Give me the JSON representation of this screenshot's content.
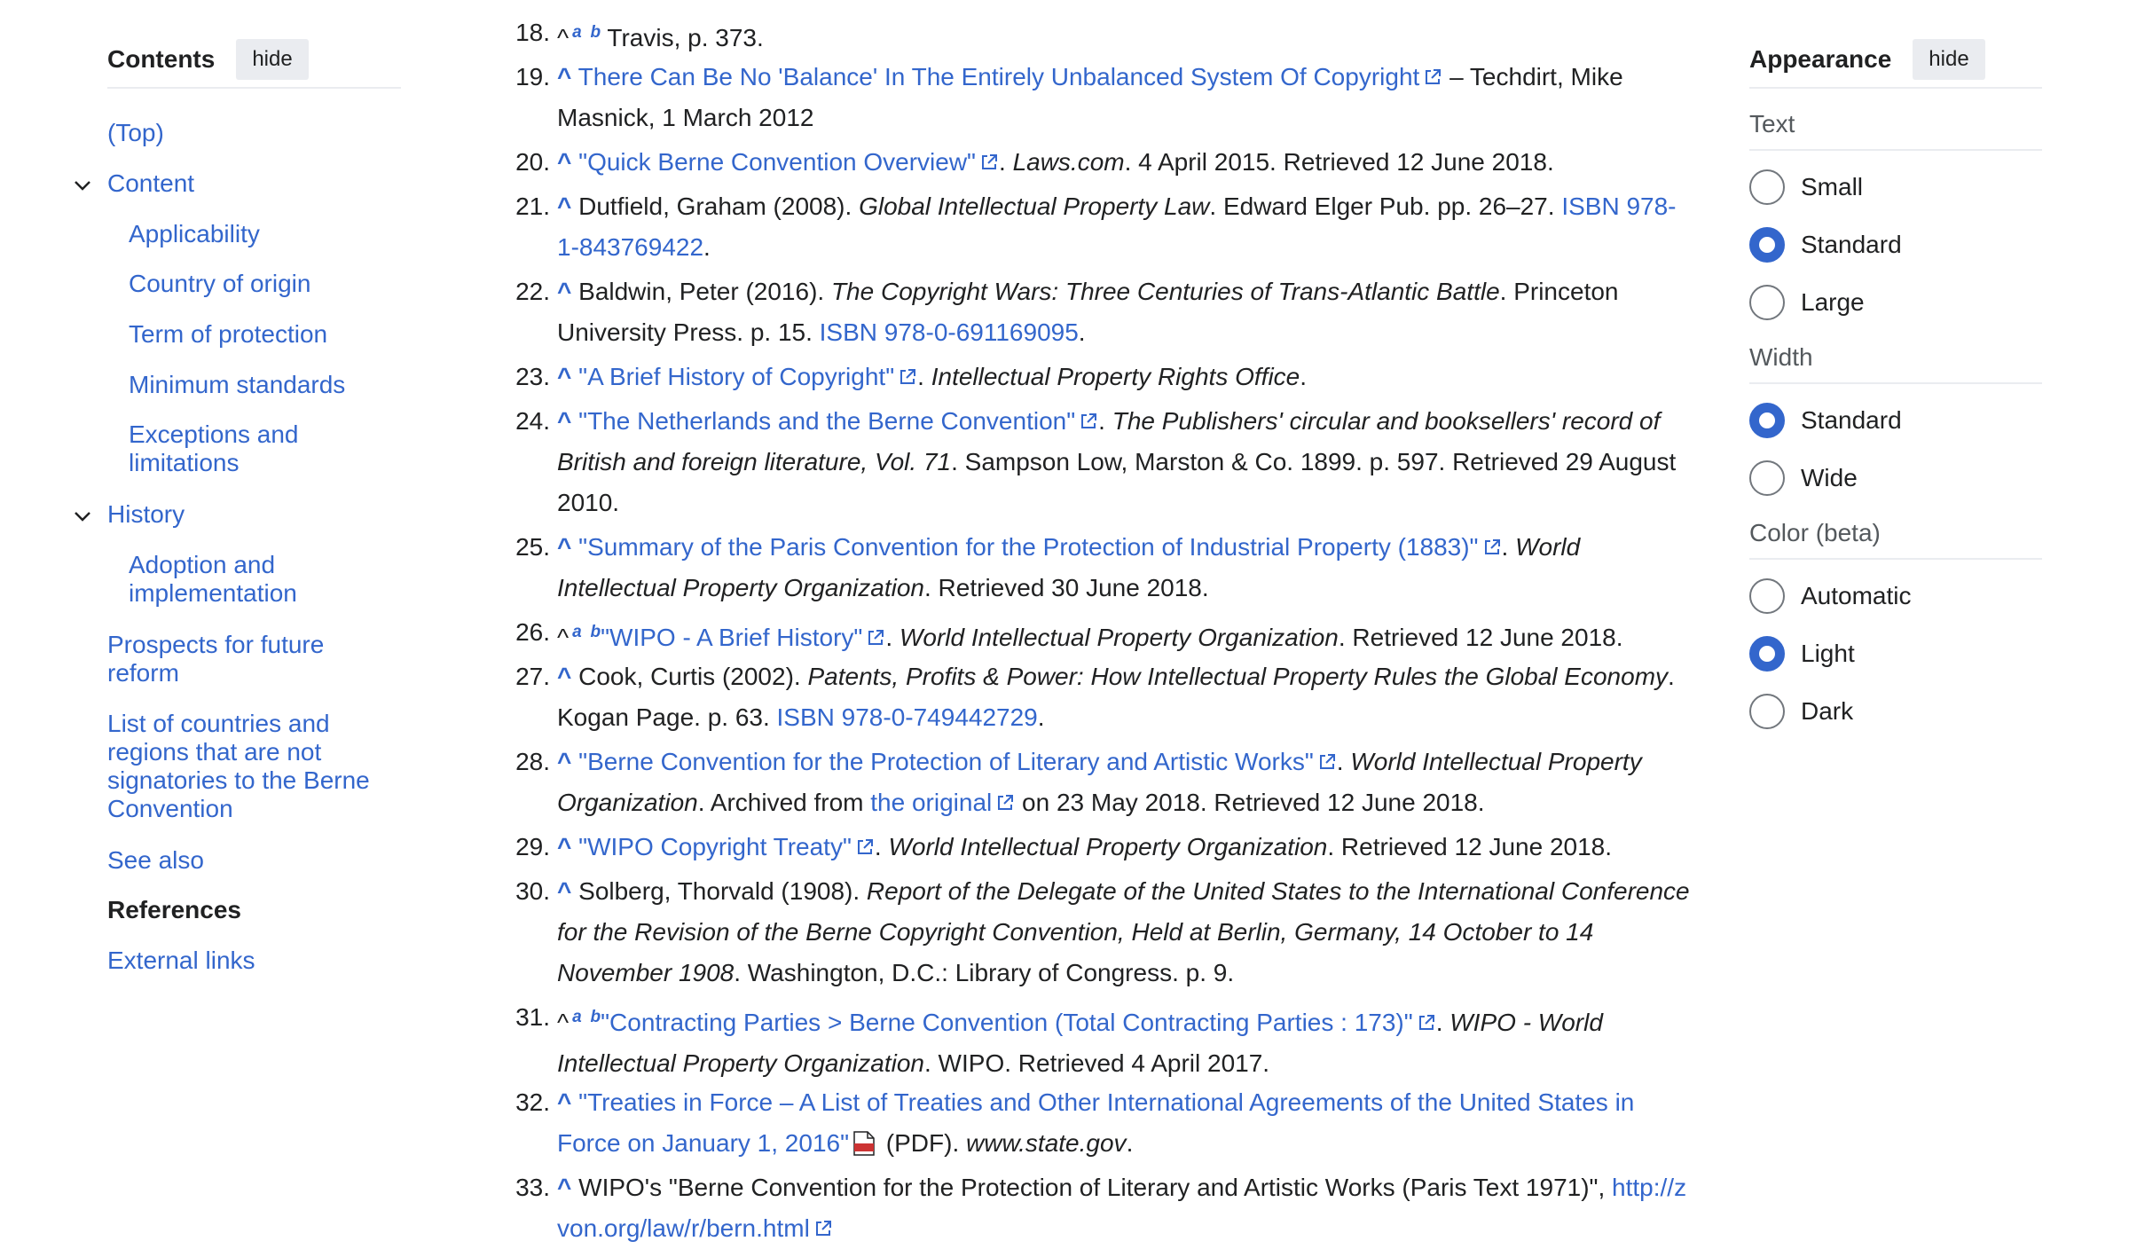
{
  "toc": {
    "title": "Contents",
    "hide_label": "hide",
    "items": [
      {
        "label": "(Top)"
      },
      {
        "label": "Content"
      },
      {
        "label": "Applicability"
      },
      {
        "label": "Country of origin"
      },
      {
        "label": "Term of protection"
      },
      {
        "label": "Minimum standards"
      },
      {
        "label": "Exceptions and limitations"
      },
      {
        "label": "History"
      },
      {
        "label": "Adoption and implementation"
      },
      {
        "label": "Prospects for future reform"
      },
      {
        "label": "List of countries and regions that are not signatories to the Berne Convention"
      },
      {
        "label": "See also"
      },
      {
        "label": "References"
      },
      {
        "label": "External links"
      }
    ],
    "current": "References"
  },
  "appearance": {
    "title": "Appearance",
    "hide_label": "hide",
    "text_label": "Text",
    "text_options": [
      "Small",
      "Standard",
      "Large"
    ],
    "text_selected": "Standard",
    "width_label": "Width",
    "width_options": [
      "Standard",
      "Wide"
    ],
    "width_selected": "Standard",
    "color_label": "Color (beta)",
    "color_options": [
      "Automatic",
      "Light",
      "Dark"
    ],
    "color_selected": "Light"
  },
  "refs": {
    "r18": {
      "num": "18.",
      "a": "a",
      "b": "b",
      "text": "Travis, p. 373."
    },
    "r19": {
      "num": "19.",
      "link": "There Can Be No 'Balance' In The Entirely Unbalanced System Of Copyright",
      "tail": " – Techdirt, Mike Masnick, 1 March 2012"
    },
    "r20": {
      "num": "20.",
      "link": "\"Quick Berne Convention Overview\"",
      "pub": "Laws.com",
      "tail": ". 4 April 2015. Retrieved 12 June 2018."
    },
    "r21": {
      "num": "21.",
      "pre": "Dutfield, Graham (2008). ",
      "title": "Global Intellectual Property Law",
      "mid": ". Edward Elger Pub. pp. 26–27.",
      "isbn": "ISBN 978-1-843769422"
    },
    "r22": {
      "num": "22.",
      "pre": "Baldwin, Peter (2016). ",
      "title": "The Copyright Wars: Three Centuries of Trans-Atlantic Battle",
      "mid": ". Princeton University Press. p. 15. ",
      "isbn": "ISBN 978-0-691169095"
    },
    "r23": {
      "num": "23.",
      "link": "\"A Brief History of Copyright\"",
      "pub": "Intellectual Property Rights Office"
    },
    "r24": {
      "num": "24.",
      "link": "\"The Netherlands and the Berne Convention\"",
      "pub": "The Publishers' circular and booksellers' record of British and foreign literature, Vol. 71",
      "tail": ". Sampson Low, Marston & Co. 1899. p. 597. Retrieved 29 August 2010."
    },
    "r25": {
      "num": "25.",
      "link": "\"Summary of the Paris Convention for the Protection of Industrial Property (1883)\"",
      "pub": "World Intellectual Property Organization",
      "tail": ". Retrieved 30 June 2018."
    },
    "r26": {
      "num": "26.",
      "a": "a",
      "b": "b",
      "link": "\"WIPO - A Brief History\"",
      "pub": "World Intellectual Property Organization",
      "tail": ". Retrieved 12 June 2018."
    },
    "r27": {
      "num": "27.",
      "pre": "Cook, Curtis (2002). ",
      "title": "Patents, Profits & Power: How Intellectual Property Rules the Global Economy",
      "mid": ". Kogan Page. p. 63. ",
      "isbn": "ISBN 978-0-749442729"
    },
    "r28": {
      "num": "28.",
      "link": "\"Berne Convention for the Protection of Literary and Artistic Works\"",
      "pub": "World Intellectual Property Organization",
      "mid": ". Archived from ",
      "orig": "the original",
      "tail": " on 23 May 2018. Retrieved 12 June 2018."
    },
    "r29": {
      "num": "29.",
      "link": "\"WIPO Copyright Treaty\"",
      "pub": "World Intellectual Property Organization",
      "tail": ". Retrieved 12 June 2018."
    },
    "r30": {
      "num": "30.",
      "pre": "Solberg, Thorvald (1908). ",
      "title": "Report of the Delegate of the United States to the International Conference for the Revision of the Berne Copyright Convention, Held at Berlin, Germany, 14 October to 14 November 1908",
      "tail": ". Washington, D.C.: Library of Congress. p. 9."
    },
    "r31": {
      "num": "31.",
      "a": "a",
      "b": "b",
      "link": "\"Contracting Parties > Berne Convention (Total Contracting Parties : 173)\"",
      "pub": "WIPO - World Intellectual Property Organization",
      "tail": ". WIPO. Retrieved 4 April 2017."
    },
    "r32": {
      "num": "32.",
      "link": "\"Treaties in Force – A List of Treaties and Other International Agreements of the United States in Force on January 1, 2016\"",
      "pdf": " (PDF). ",
      "pub": "www.state.gov",
      "tail": "."
    },
    "r33": {
      "num": "33.",
      "pre": "WIPO's \"Berne Convention for the Protection of Literary and Artistic Works (Paris Text 1971)\", ",
      "link": "http://zvon.org/law/r/bern.html"
    }
  }
}
